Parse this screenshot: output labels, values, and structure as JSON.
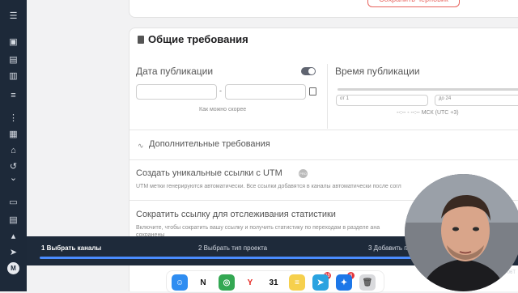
{
  "sidebar": {
    "icons": [
      "menu-icon",
      "briefcase-icon",
      "image-icon",
      "document-icon",
      "list-icon",
      "filter-list-icon",
      "grid-icon",
      "bank-icon",
      "history-icon",
      "chevron-down-icon",
      "chat-icon",
      "clipboard-icon",
      "megaphone-icon",
      "send-icon",
      "m-logo-icon"
    ]
  },
  "top_button": {
    "label": "Сохранить черновик"
  },
  "section": {
    "title": "Общие требования",
    "publication_date": {
      "label": "Дата публикации",
      "dash": "-",
      "hint": "Как можно скорее"
    },
    "publication_time": {
      "label": "Время публикации",
      "from_placeholder": "от  1",
      "to_placeholder": "до  24",
      "tz_hint": "--:-- - --:-- МСК (UTC +3)"
    },
    "extra": {
      "title": "Дополнительные требования"
    },
    "utm": {
      "title": "Создать уникальные ссылки с UTM",
      "badge": "PRO",
      "desc": "UTM метки генерируются автоматически. Все ссылки добавятся в каналы автоматически после согл"
    },
    "shorten": {
      "title": "Сократить ссылку для отслеживания статистики",
      "desc1": "Включите, чтобы сократить вашу ссылку и получить статистику по переходам в разделе ана",
      "desc2": "сохранены"
    }
  },
  "stepper": {
    "steps": [
      {
        "label": "1 Выбрать каналы"
      },
      {
        "label": "2 Выбрать тип проекта"
      },
      {
        "label": "3 Добавить п"
      }
    ],
    "ghost": "02-06T"
  },
  "dock": {
    "apps": [
      {
        "name": "finder-icon",
        "color": "#2f8df1",
        "glyph": "☺"
      },
      {
        "name": "notion-icon",
        "color": "#ffffff",
        "glyph": "N",
        "text": "#111"
      },
      {
        "name": "chrome-icon",
        "color": "#34a853",
        "glyph": "◎"
      },
      {
        "name": "yandex-browser-icon",
        "color": "#ffffff",
        "glyph": "Y",
        "text": "#e52620"
      },
      {
        "name": "calendar-icon",
        "color": "#ffffff",
        "glyph": "31",
        "text": "#111"
      },
      {
        "name": "notes-icon",
        "color": "#f6d04d",
        "glyph": "≡"
      },
      {
        "name": "telegram-icon",
        "color": "#2aa3e0",
        "glyph": "➤",
        "badge": "28"
      },
      {
        "name": "safari-icon",
        "color": "#1d77e8",
        "glyph": "✦",
        "badge": "8"
      },
      {
        "name": "trash-icon",
        "color": "#d9dadd",
        "glyph": "🗑",
        "text": "#555"
      }
    ]
  }
}
